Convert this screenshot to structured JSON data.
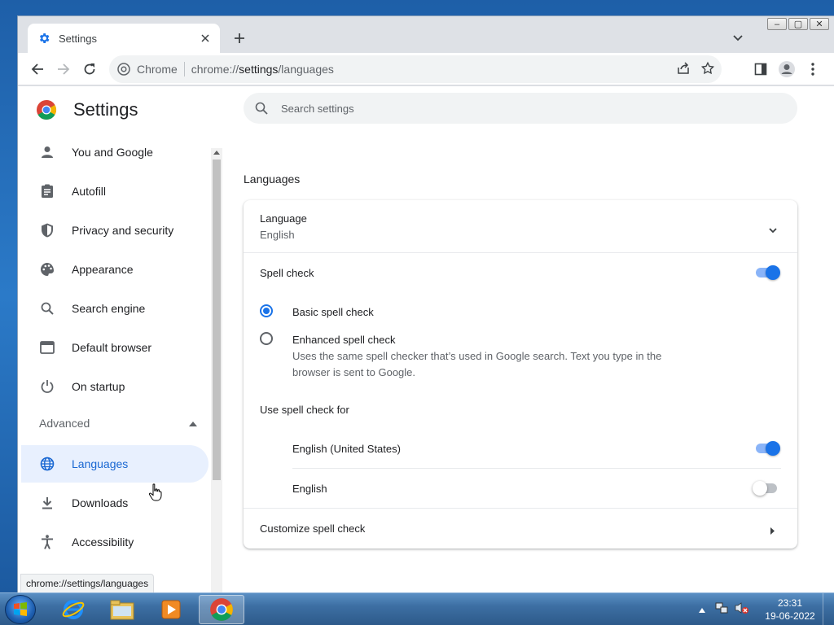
{
  "window": {
    "tab_title": "Settings",
    "omnibox_chip": "Chrome",
    "url_scheme": "chrome://",
    "url_host": "settings",
    "url_path": "/languages"
  },
  "settings": {
    "title": "Settings",
    "search_placeholder": "Search settings"
  },
  "nav": {
    "items": [
      {
        "label": "You and Google",
        "icon": "person-icon"
      },
      {
        "label": "Autofill",
        "icon": "clipboard-icon"
      },
      {
        "label": "Privacy and security",
        "icon": "shield-icon"
      },
      {
        "label": "Appearance",
        "icon": "palette-icon"
      },
      {
        "label": "Search engine",
        "icon": "search-icon"
      },
      {
        "label": "Default browser",
        "icon": "browser-icon"
      },
      {
        "label": "On startup",
        "icon": "power-icon"
      }
    ],
    "advanced_label": "Advanced",
    "advanced_items": [
      {
        "label": "Languages",
        "icon": "globe-icon",
        "active": true
      },
      {
        "label": "Downloads",
        "icon": "download-icon"
      },
      {
        "label": "Accessibility",
        "icon": "accessibility-icon"
      }
    ]
  },
  "languages": {
    "section_title": "Languages",
    "language_label": "Language",
    "language_value": "English",
    "spell_check_label": "Spell check",
    "spell_check_on": true,
    "basic_label": "Basic spell check",
    "enhanced_label": "Enhanced spell check",
    "enhanced_desc_line1": "Uses the same spell checker that’s used in Google search. Text you type in the",
    "enhanced_desc_line2": "browser is sent to Google.",
    "use_for_label": "Use spell check for",
    "langs": [
      {
        "label": "English (United States)",
        "on": true
      },
      {
        "label": "English",
        "on": false
      }
    ],
    "customize_label": "Customize spell check"
  },
  "status_bar_url": "chrome://settings/languages",
  "taskbar": {
    "time": "23:31",
    "date": "19-06-2022"
  },
  "colors": {
    "accent": "#1a73e8",
    "active_nav_bg": "#e8f0fe",
    "active_nav_text": "#1967d2"
  }
}
